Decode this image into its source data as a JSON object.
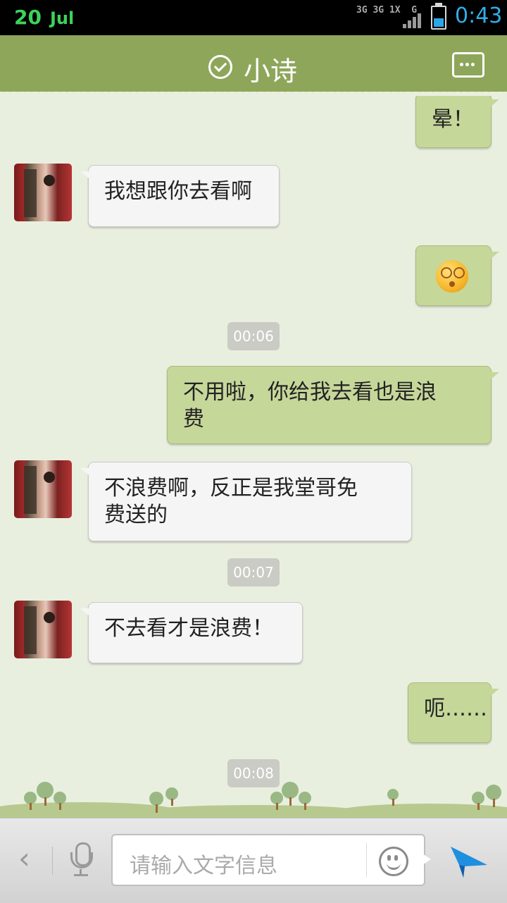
{
  "status_bar": {
    "day": "20",
    "month": "Jul",
    "network": "3G 3G 1X  G",
    "time": "0:43",
    "battery_level": 0.45
  },
  "header": {
    "title": "小诗"
  },
  "messages": [
    {
      "side": "out",
      "text": "晕！"
    },
    {
      "side": "in",
      "text": "我想跟你去看啊"
    },
    {
      "side": "out",
      "emoji": "dizzy-face-icon"
    },
    {
      "time": "00:06"
    },
    {
      "side": "out",
      "text": "不用啦，你给我去看也是浪\n费"
    },
    {
      "side": "in",
      "text": "不浪费啊，反正是我堂哥免\n费送的"
    },
    {
      "time": "00:07"
    },
    {
      "side": "in",
      "text": "不去看才是浪费！"
    },
    {
      "side": "out",
      "text": "呃……"
    },
    {
      "time": "00:08"
    }
  ],
  "input": {
    "placeholder": "请输入文字信息"
  },
  "colors": {
    "header": "#8ea65a",
    "outgoing_bubble": "#c6d79a",
    "incoming_bubble": "#f5f5f5",
    "background": "#e9efdf",
    "send": "#1f8fe0"
  }
}
